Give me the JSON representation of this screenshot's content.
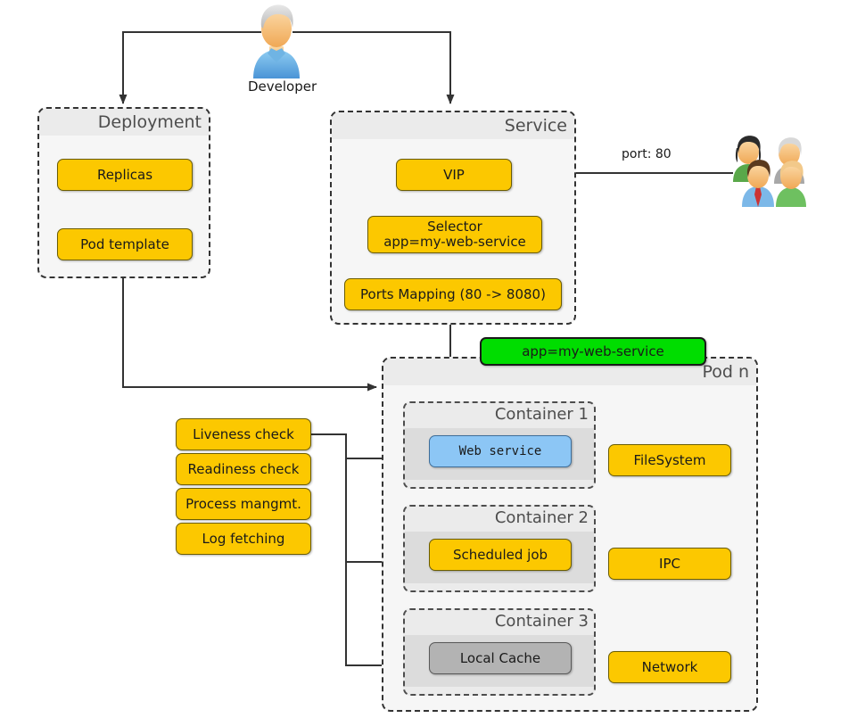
{
  "diagram": {
    "title": "Kubernetes Deployment / Service / Pod architecture",
    "colors": {
      "yellow": "#fcc800",
      "blue": "#8cc6f5",
      "gray": "#b3b3b3",
      "green": "#00dd00",
      "group_fill": "#f6f6f6",
      "band_fill": "#ebebeb",
      "stroke": "#333333"
    }
  },
  "actors": {
    "developer": {
      "label": "Developer",
      "icon": "user-icon"
    },
    "users": {
      "label": "",
      "icon": "users-group-icon"
    }
  },
  "groups": {
    "deployment": {
      "title": "Deployment"
    },
    "service": {
      "title": "Service"
    },
    "pod": {
      "title": "Pod n"
    },
    "container1": {
      "title": "Container 1"
    },
    "container2": {
      "title": "Container 2"
    },
    "container3": {
      "title": "Container 3"
    }
  },
  "nodes": {
    "replicas": {
      "label": "Replicas"
    },
    "pod_template": {
      "label": "Pod template"
    },
    "vip": {
      "label": "VIP"
    },
    "selector": {
      "label": "Selector\napp=my-web-service"
    },
    "ports_mapping": {
      "label": "Ports Mapping (80 -> 8080)"
    },
    "pod_label": {
      "label": "app=my-web-service"
    },
    "web_service": {
      "label": "Web service"
    },
    "scheduled_job": {
      "label": "Scheduled job"
    },
    "local_cache": {
      "label": "Local Cache"
    },
    "filesystem": {
      "label": "FileSystem"
    },
    "ipc": {
      "label": "IPC"
    },
    "network": {
      "label": "Network"
    },
    "liveness_check": {
      "label": "Liveness check"
    },
    "readiness_check": {
      "label": "Readiness check"
    },
    "process_mangmt": {
      "label": "Process mangmt."
    },
    "log_fetching": {
      "label": "Log fetching"
    }
  },
  "edge_labels": {
    "port_80": "port: 80"
  }
}
